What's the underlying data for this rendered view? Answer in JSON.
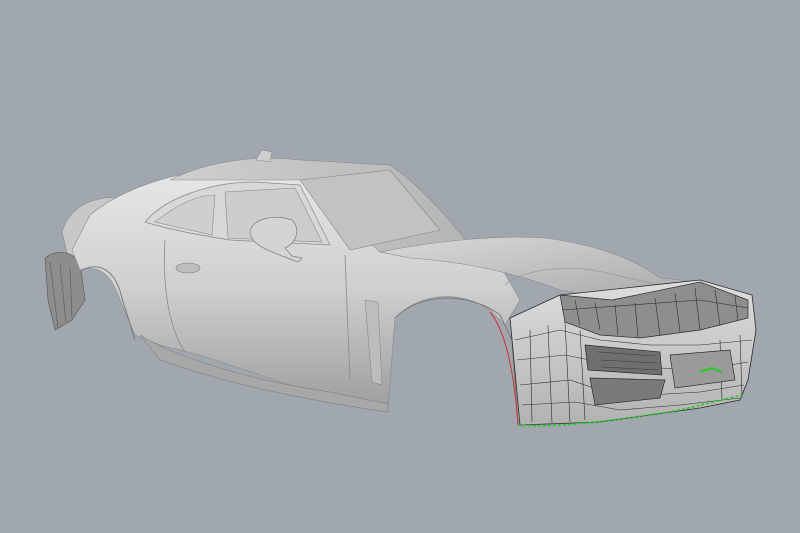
{
  "viewport": {
    "background_color": "#a0a7af",
    "body_color": "#d2d2d2",
    "body_shadow_color": "#9a9a9a",
    "wireframe_color": "#2b2b2b",
    "highlight_green": "#22cc22",
    "highlight_red": "#cc3333"
  }
}
